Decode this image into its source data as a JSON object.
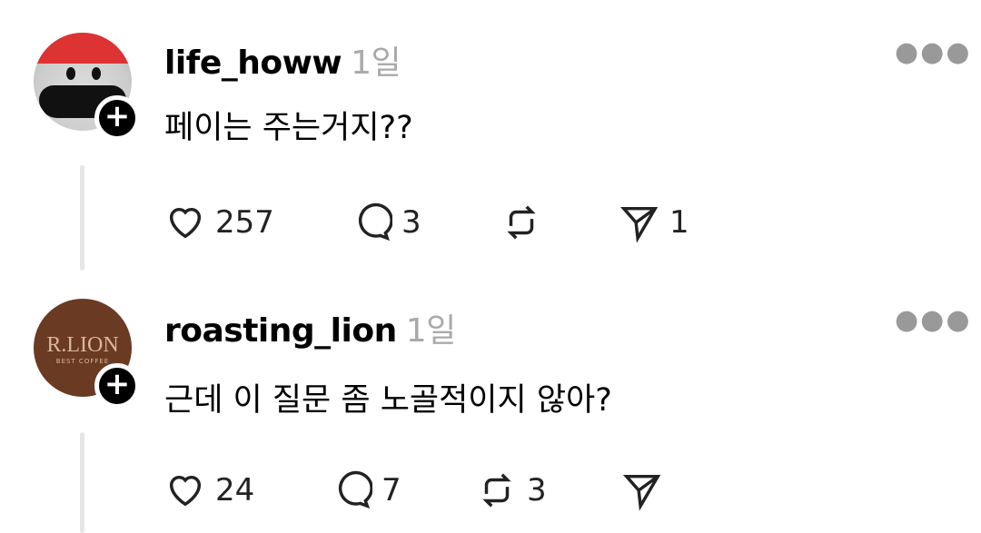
{
  "posts": [
    {
      "username": "life_howw",
      "time": "1일",
      "text": "페이는 주는거지??",
      "likes": "257",
      "replies": "3",
      "reposts": "",
      "shares": "1"
    },
    {
      "username": "roasting_lion",
      "time": "1일",
      "text": "근데 이 질문 좀 노골적이지 않아?",
      "likes": "24",
      "replies": "7",
      "reposts": "3",
      "shares": "",
      "avatar_text": "R.LION",
      "avatar_subtext": "BEST COFFEE"
    }
  ],
  "icons": {
    "like": "heart-icon",
    "reply": "comment-icon",
    "repost": "repost-icon",
    "share": "send-icon",
    "follow": "plus-icon",
    "more": "more-icon"
  }
}
